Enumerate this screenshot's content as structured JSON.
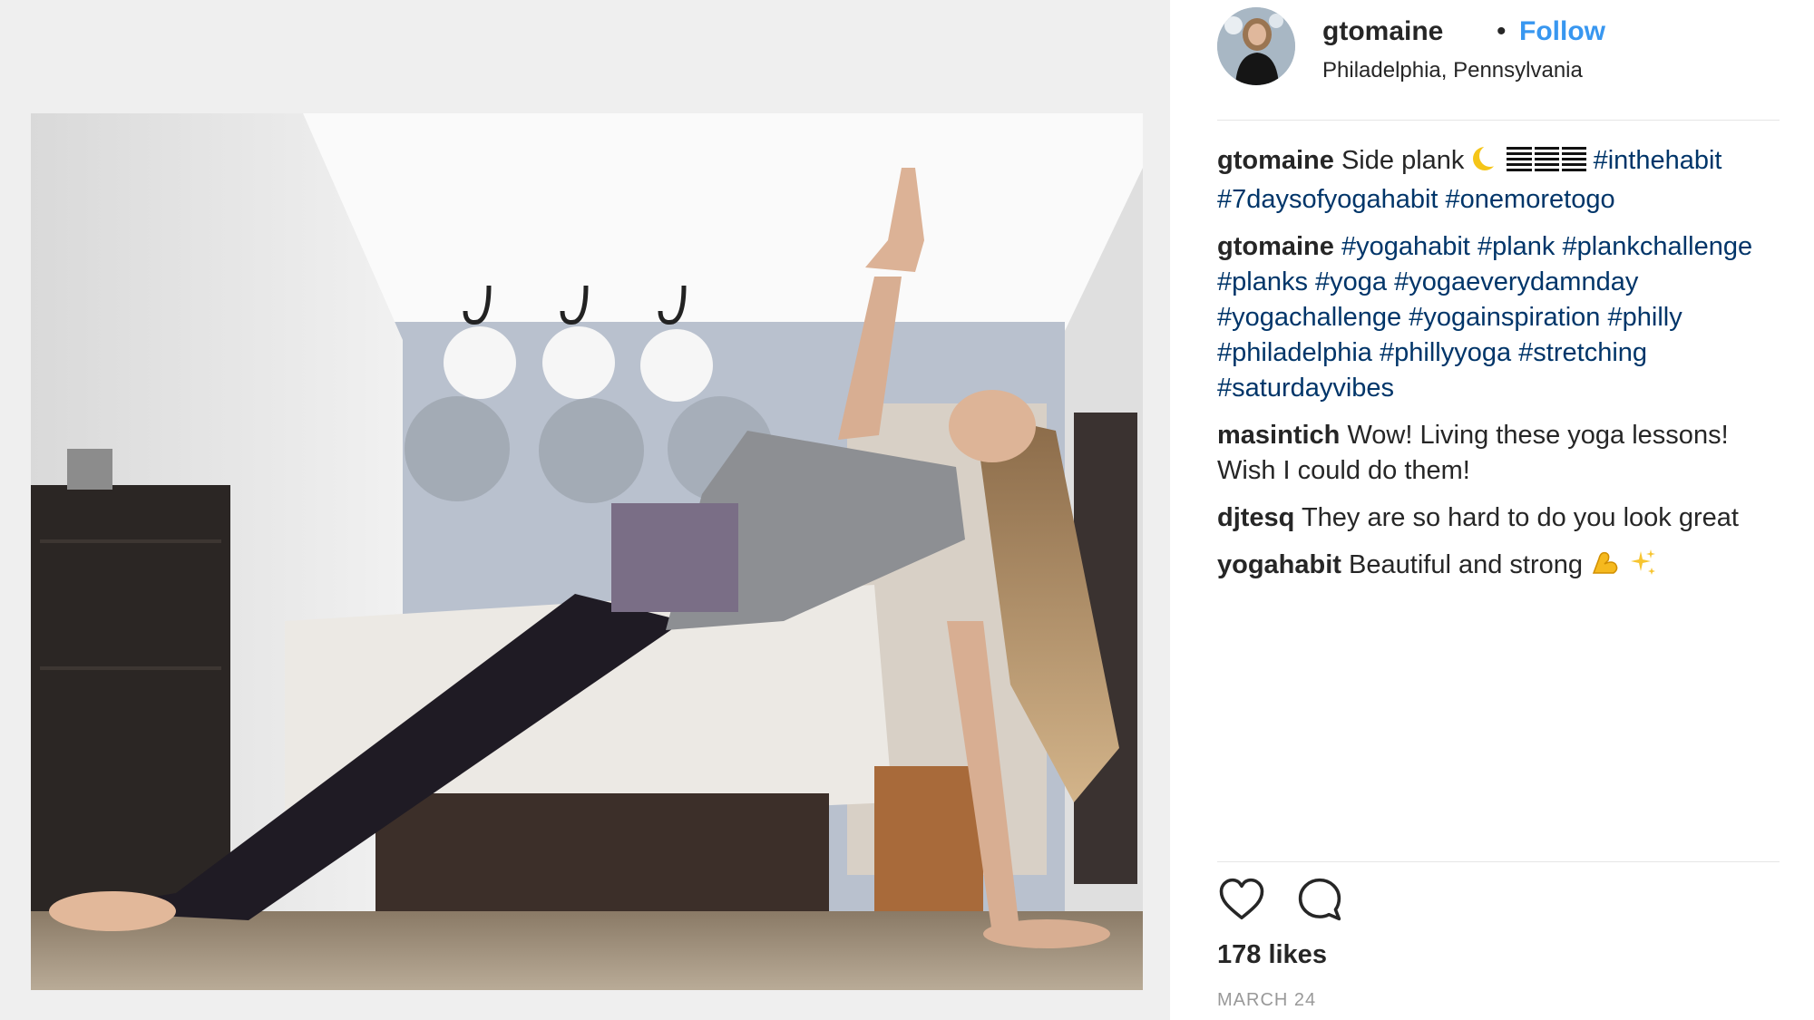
{
  "post": {
    "image_alt": "Woman holding a side plank pose on a rug in a bedroom",
    "author": {
      "username": "gtomaine",
      "separator": "•",
      "follow_label": "Follow",
      "location": "Philadelphia, Pennsylvania"
    },
    "comments": [
      {
        "user": "gtomaine",
        "text": "Side plank",
        "emoji": [
          "crescent-moon",
          "bars"
        ],
        "tags": [
          "#inthehabit",
          "#7daysofyogahabit",
          "#onemoretogo"
        ]
      },
      {
        "user": "gtomaine",
        "text": "",
        "tags": [
          "#yogahabit",
          "#plank",
          "#plankchallenge",
          "#planks",
          "#yoga",
          "#yogaeverydamnday",
          "#yogachallenge",
          "#yogainspiration",
          "#philly",
          "#philadelphia",
          "#phillyyoga",
          "#stretching",
          "#saturdayvibes"
        ]
      },
      {
        "user": "masintich",
        "text": "Wow! Living these yoga lessons! Wish I could do them!"
      },
      {
        "user": "djtesq",
        "text": "They are so hard to do you look great"
      },
      {
        "user": "yogahabit",
        "text": "Beautiful and strong",
        "emoji": [
          "flexed-biceps",
          "sparkles"
        ]
      }
    ],
    "actions": {
      "like_icon": "heart-outline-icon",
      "comment_icon": "speech-bubble-icon"
    },
    "likes_text": "178 likes",
    "date_text": "MARCH 24",
    "colors": {
      "hashtag": "#003569",
      "follow": "#3897f0",
      "muted": "#999999"
    }
  }
}
